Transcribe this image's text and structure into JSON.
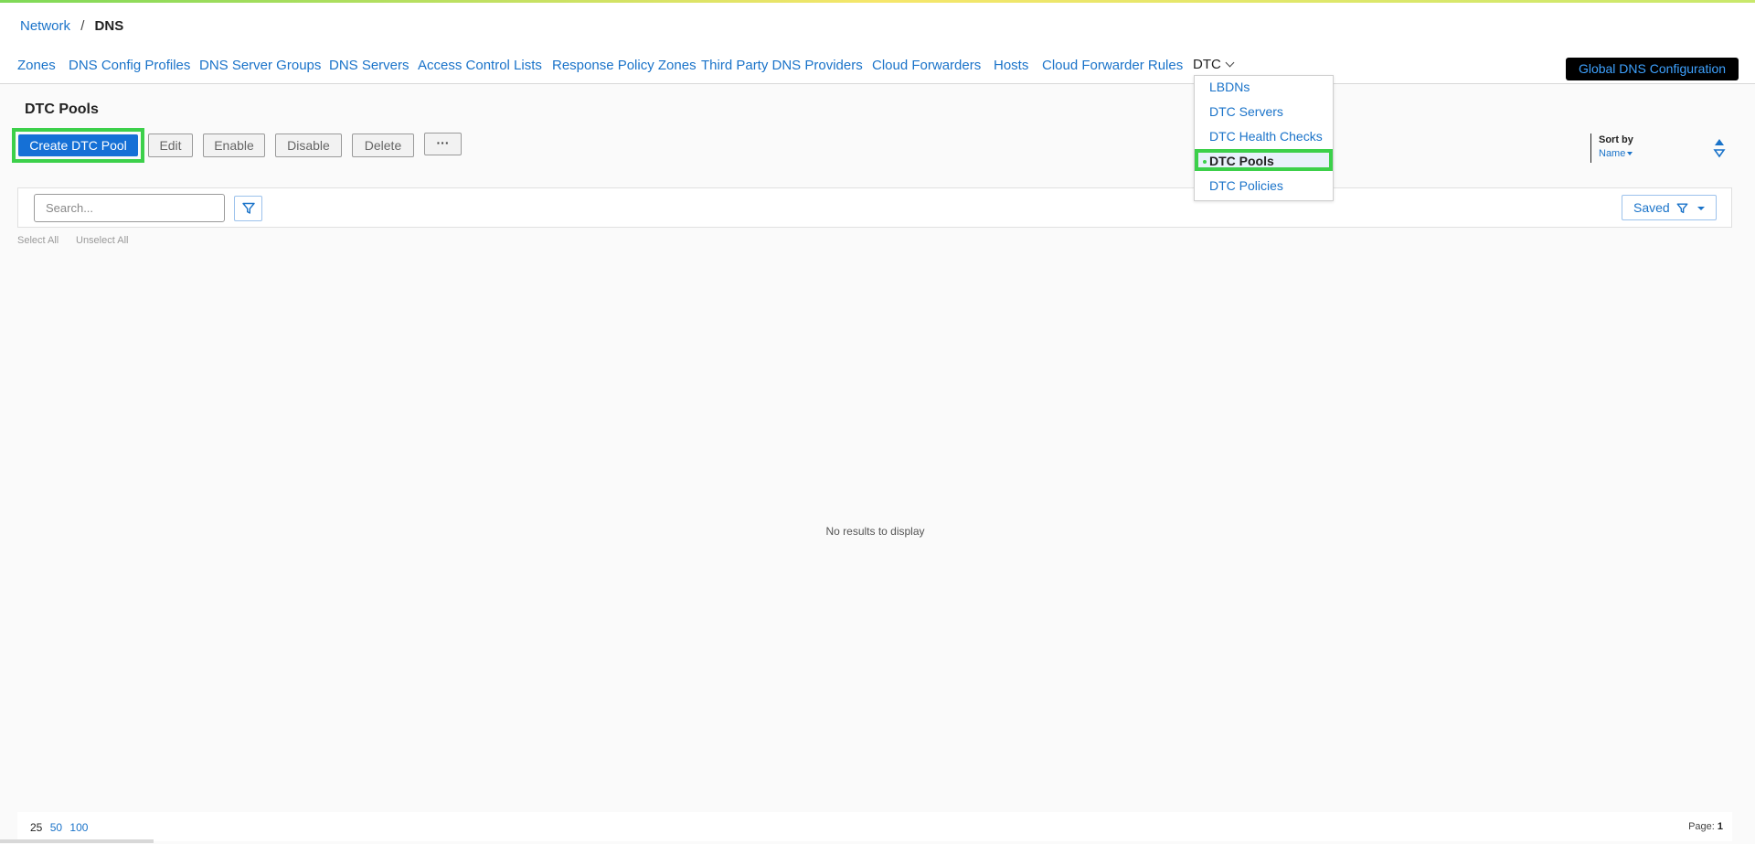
{
  "breadcrumb": {
    "parent": "Network",
    "separator": "/",
    "current": "DNS"
  },
  "tabs": [
    "Zones",
    "DNS Config Profiles",
    "DNS Server Groups",
    "DNS Servers",
    "Access Control Lists",
    "Response Policy Zones",
    "Third Party DNS Providers",
    "Cloud Forwarders",
    "Hosts",
    "Cloud Forwarder Rules",
    "DTC"
  ],
  "global_button": "Global DNS Configuration",
  "dropdown": {
    "items": [
      "LBDNs",
      "DTC Servers",
      "DTC Health Checks",
      "DTC Pools",
      "DTC Policies"
    ],
    "active": "DTC Pools"
  },
  "page_title": "DTC Pools",
  "toolbar": {
    "create": "Create DTC Pool",
    "edit": "Edit",
    "enable": "Enable",
    "disable": "Disable",
    "delete": "Delete",
    "more": "···"
  },
  "sort": {
    "label": "Sort by",
    "value": "Name"
  },
  "search": {
    "placeholder": "Search..."
  },
  "saved_label": "Saved",
  "select_all": "Select All",
  "unselect_all": "Unselect All",
  "empty_message": "No results to display",
  "pager": {
    "sizes": [
      "25",
      "50",
      "100"
    ],
    "current_size": "25",
    "page_label": "Page:",
    "page": "1"
  },
  "colors": {
    "accent": "#1570d6",
    "link": "#1a73c9",
    "highlight": "#3cd04a"
  }
}
